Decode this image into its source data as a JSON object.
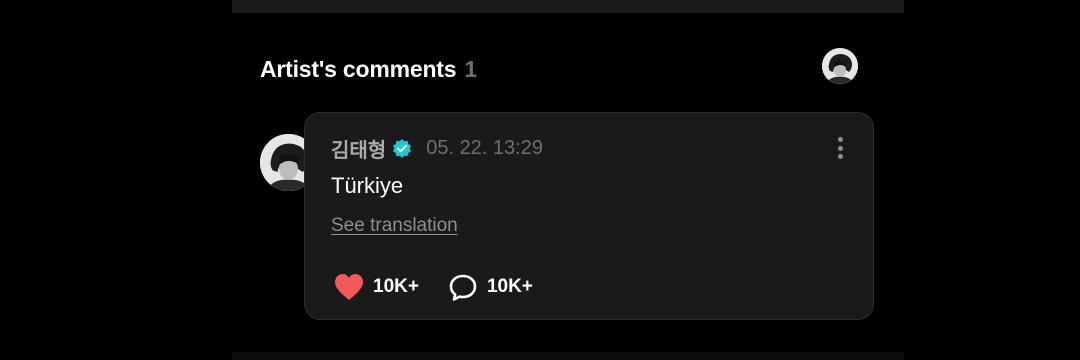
{
  "section": {
    "title": "Artist's comments",
    "count": "1"
  },
  "comment": {
    "author": "김태형",
    "verified": true,
    "timestamp": "05. 22. 13:29",
    "text": "Türkiye",
    "translate_label": "See translation",
    "likes": "10K+",
    "replies": "10K+"
  },
  "icons": {
    "verified": "verified-badge-icon",
    "more": "more-vertical-icon",
    "like": "heart-icon",
    "reply": "comment-bubble-icon"
  },
  "colors": {
    "background": "#000000",
    "card": "#1a1a1c",
    "heart": "#f25a5a",
    "verified": "#1fc6d8"
  }
}
